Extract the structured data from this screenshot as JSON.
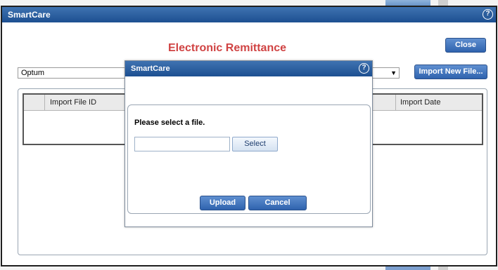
{
  "window": {
    "title": "SmartCare"
  },
  "page": {
    "heading": "Electronic Remittance",
    "close_label": "Close",
    "import_label": "Import New File...",
    "payer_selected": "Optum",
    "grid_headers": [
      "Import File ID",
      "Import Date"
    ]
  },
  "modal": {
    "title": "SmartCare",
    "prompt": "Please select a file.",
    "file_value": "",
    "select_label": "Select",
    "upload_label": "Upload",
    "cancel_label": "Cancel"
  },
  "icons": {
    "help": "help-icon",
    "dropdown": "chevron-down-icon"
  },
  "colors": {
    "titlebar": "#1d4f91",
    "heading": "#d04343",
    "button": "#2f63ae"
  }
}
